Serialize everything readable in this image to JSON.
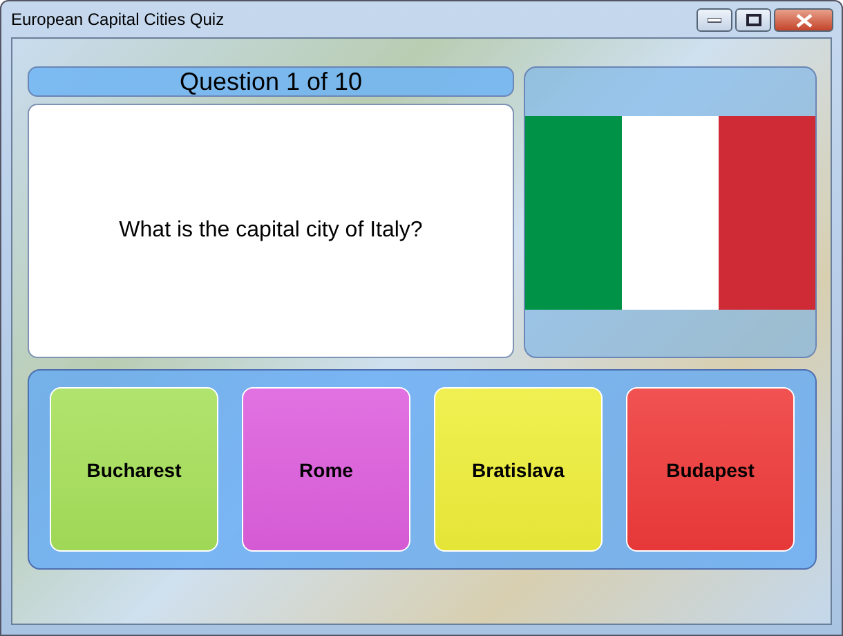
{
  "window": {
    "title": "European Capital Cities Quiz"
  },
  "question": {
    "header": "Question 1 of 10",
    "text": "What is the capital city of Italy?"
  },
  "answers": [
    {
      "label": "Bucharest",
      "color": "#a6e05a"
    },
    {
      "label": "Rome",
      "color": "#dd5edd"
    },
    {
      "label": "Bratislava",
      "color": "#eeee3a"
    },
    {
      "label": "Budapest",
      "color": "#ef3a3a"
    }
  ]
}
